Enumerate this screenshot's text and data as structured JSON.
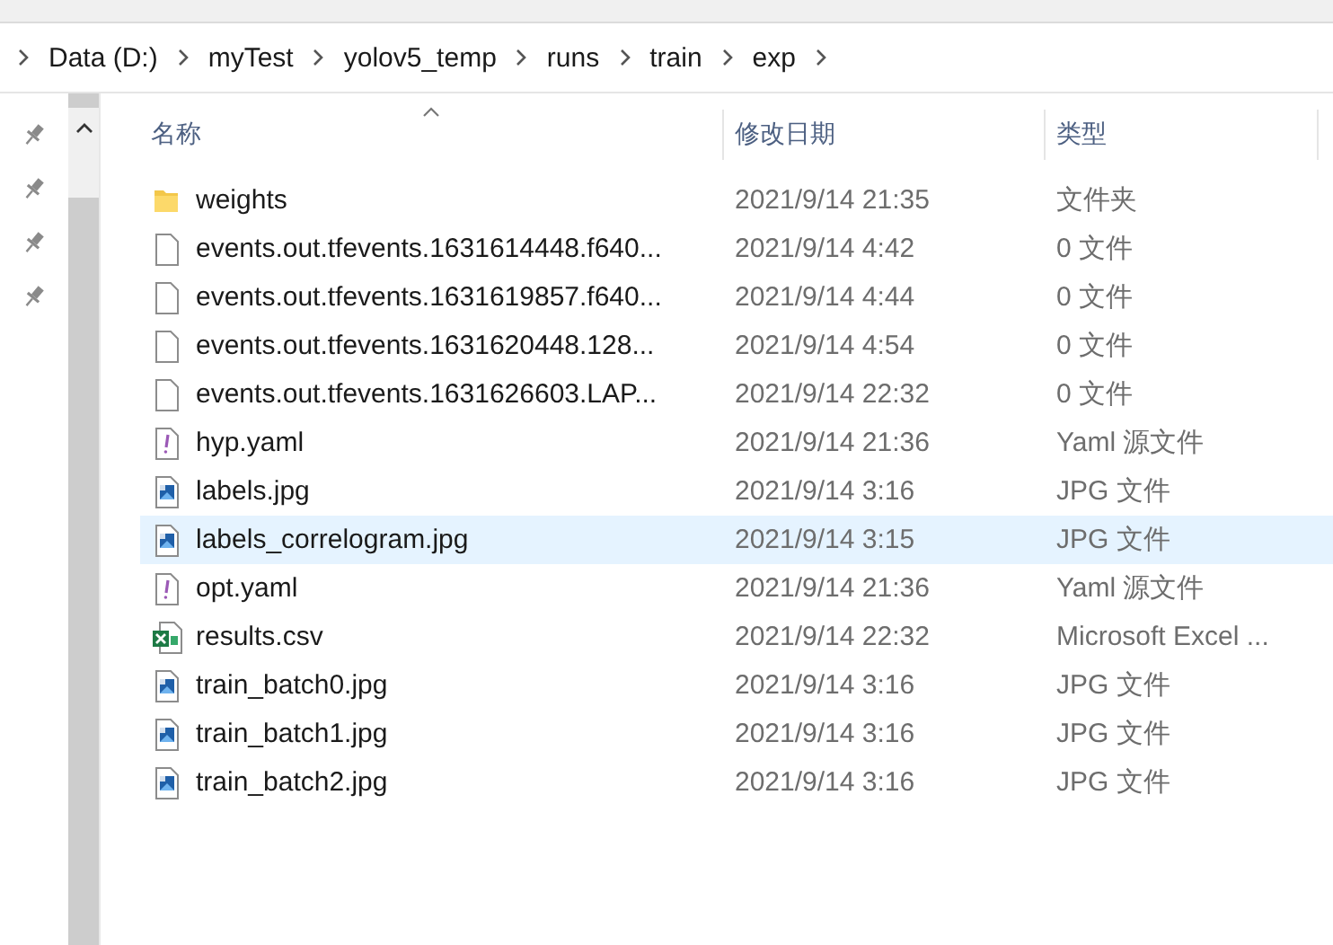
{
  "breadcrumb": [
    {
      "label": "Data (D:)"
    },
    {
      "label": "myTest"
    },
    {
      "label": "yolov5_temp"
    },
    {
      "label": "runs"
    },
    {
      "label": "train"
    },
    {
      "label": "exp"
    }
  ],
  "columns": [
    {
      "label": "名称",
      "sorted": true
    },
    {
      "label": "修改日期",
      "sorted": false
    },
    {
      "label": "类型",
      "sorted": false
    }
  ],
  "rows": [
    {
      "kind": "folder",
      "name": "weights",
      "modified": "2021/9/14 21:35",
      "type": "文件夹",
      "selected": false
    },
    {
      "kind": "file",
      "name": "events.out.tfevents.1631614448.f640...",
      "modified": "2021/9/14 4:42",
      "type": "0 文件",
      "selected": false
    },
    {
      "kind": "file",
      "name": "events.out.tfevents.1631619857.f640...",
      "modified": "2021/9/14 4:44",
      "type": "0 文件",
      "selected": false
    },
    {
      "kind": "file",
      "name": "events.out.tfevents.1631620448.128...",
      "modified": "2021/9/14 4:54",
      "type": "0 文件",
      "selected": false
    },
    {
      "kind": "file",
      "name": "events.out.tfevents.1631626603.LAP...",
      "modified": "2021/9/14 22:32",
      "type": "0 文件",
      "selected": false
    },
    {
      "kind": "yaml",
      "name": "hyp.yaml",
      "modified": "2021/9/14 21:36",
      "type": "Yaml 源文件",
      "selected": false
    },
    {
      "kind": "image",
      "name": "labels.jpg",
      "modified": "2021/9/14 3:16",
      "type": "JPG 文件",
      "selected": false
    },
    {
      "kind": "image",
      "name": "labels_correlogram.jpg",
      "modified": "2021/9/14 3:15",
      "type": "JPG 文件",
      "selected": true
    },
    {
      "kind": "yaml",
      "name": "opt.yaml",
      "modified": "2021/9/14 21:36",
      "type": "Yaml 源文件",
      "selected": false
    },
    {
      "kind": "excel",
      "name": "results.csv",
      "modified": "2021/9/14 22:32",
      "type": "Microsoft Excel ...",
      "selected": false
    },
    {
      "kind": "image",
      "name": "train_batch0.jpg",
      "modified": "2021/9/14 3:16",
      "type": "JPG 文件",
      "selected": false
    },
    {
      "kind": "image",
      "name": "train_batch1.jpg",
      "modified": "2021/9/14 3:16",
      "type": "JPG 文件",
      "selected": false
    },
    {
      "kind": "image",
      "name": "train_batch2.jpg",
      "modified": "2021/9/14 3:16",
      "type": "JPG 文件",
      "selected": false
    }
  ]
}
